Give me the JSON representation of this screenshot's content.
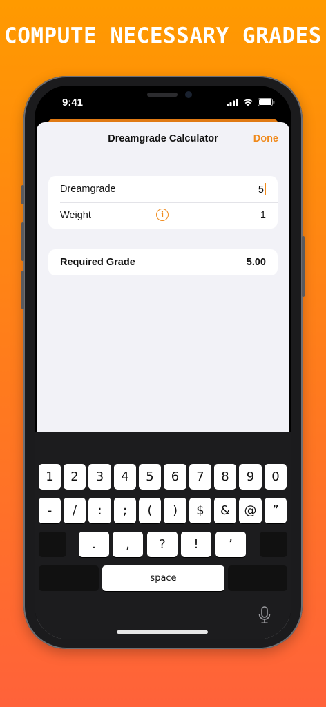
{
  "headline": "COMPUTE NECESSARY GRADES",
  "status_bar": {
    "time": "9:41"
  },
  "nav": {
    "title": "Dreamgrade Calculator",
    "done": "Done"
  },
  "form": {
    "dreamgrade_label": "Dreamgrade",
    "dreamgrade_value": "5",
    "weight_label": "Weight",
    "weight_value": "1",
    "required_label": "Required Grade",
    "required_value": "5.00"
  },
  "keyboard": {
    "row1": [
      "1",
      "2",
      "3",
      "4",
      "5",
      "6",
      "7",
      "8",
      "9",
      "0"
    ],
    "row2": [
      "-",
      "/",
      ":",
      ";",
      "(",
      ")",
      "$",
      "&",
      "@",
      "”"
    ],
    "row3": [
      ".",
      ",",
      "?",
      "!",
      "’"
    ],
    "space": "space"
  },
  "colors": {
    "accent": "#F08A1C",
    "background_top": "#FF9A00",
    "background_bottom": "#FF623A"
  }
}
